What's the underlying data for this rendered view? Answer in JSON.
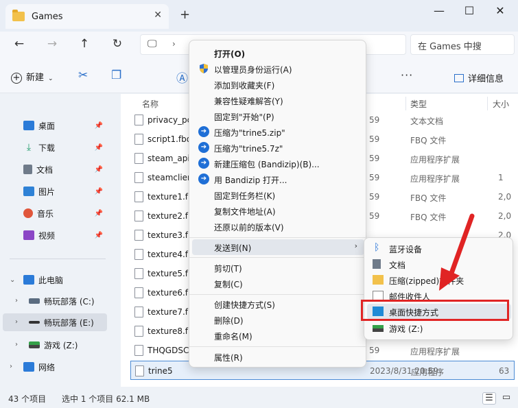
{
  "window": {
    "tab_title": "Games",
    "new_tab": "+",
    "minimize": "—",
    "maximize": "☐",
    "close": "✕"
  },
  "nav": {
    "search_placeholder": "在 Games 中搜"
  },
  "toolbar": {
    "new_label": "新建",
    "details_label": "详细信息"
  },
  "sidebar": {
    "quick": [
      {
        "label": "桌面",
        "color": "#2b7bd8"
      },
      {
        "label": "下载",
        "color": "#1e9a6a"
      },
      {
        "label": "文档",
        "color": "#6f7b8a"
      },
      {
        "label": "图片",
        "color": "#2f82d6"
      },
      {
        "label": "音乐",
        "color": "#e0563b"
      },
      {
        "label": "视频",
        "color": "#8b46c6"
      }
    ],
    "this_pc": "此电脑",
    "drives": [
      "畅玩部落 (C:)",
      "畅玩部落 (E:)",
      "游戏 (Z:)"
    ],
    "network": "网络"
  },
  "columns": {
    "name": "名称",
    "type": "类型",
    "size": "大小"
  },
  "files": [
    {
      "name": "privacy_pc",
      "date": "59",
      "type": "文本文档",
      "size": ""
    },
    {
      "name": "script1.fbq",
      "date": "59",
      "type": "FBQ 文件",
      "size": ""
    },
    {
      "name": "steam_api",
      "date": "59",
      "type": "应用程序扩展",
      "size": ""
    },
    {
      "name": "steamclien",
      "date": "59",
      "type": "应用程序扩展",
      "size": "1"
    },
    {
      "name": "texture1.fb",
      "date": "59",
      "type": "FBQ 文件",
      "size": "2,0"
    },
    {
      "name": "texture2.fb",
      "date": "59",
      "type": "FBQ 文件",
      "size": "2,0"
    },
    {
      "name": "texture3.fb",
      "date": "",
      "type": "",
      "size": "2,0"
    },
    {
      "name": "texture4.fb",
      "date": "",
      "type": "",
      "size": ""
    },
    {
      "name": "texture5.fb",
      "date": "",
      "type": "",
      "size": ""
    },
    {
      "name": "texture6.fb",
      "date": "",
      "type": "",
      "size": ""
    },
    {
      "name": "texture7.fb",
      "date": "",
      "type": "",
      "size": ""
    },
    {
      "name": "texture8.fb",
      "date": "",
      "type": "",
      "size": ""
    },
    {
      "name": "THQGDSC",
      "date": "59",
      "type": "应用程序扩展",
      "size": ""
    },
    {
      "name": "trine5",
      "date": "2023/8/31 20:59",
      "type": "应用程序",
      "size": "63"
    }
  ],
  "status": {
    "count": "43 个项目",
    "selected": "选中 1 个项目  62.1 MB"
  },
  "context_menu": [
    {
      "label": "打开(O)",
      "bold": true
    },
    {
      "label": "以管理员身份运行(A)"
    },
    {
      "label": "添加到收藏夹(F)"
    },
    {
      "label": "兼容性疑难解答(Y)"
    },
    {
      "label": "固定到\"开始\"(P)"
    },
    {
      "label": "压缩为\"trine5.zip\""
    },
    {
      "label": "压缩为\"trine5.7z\""
    },
    {
      "label": "新建压缩包 (Bandizip)(B)..."
    },
    {
      "label": "用 Bandizip 打开..."
    },
    {
      "label": "固定到任务栏(K)"
    },
    {
      "label": "复制文件地址(A)"
    },
    {
      "label": "还原以前的版本(V)"
    },
    {
      "label": "发送到(N)"
    },
    {
      "label": "剪切(T)"
    },
    {
      "label": "复制(C)"
    },
    {
      "label": "创建快捷方式(S)"
    },
    {
      "label": "删除(D)"
    },
    {
      "label": "重命名(M)"
    },
    {
      "label": "属性(R)"
    }
  ],
  "send_to": [
    {
      "label": "蓝牙设备"
    },
    {
      "label": "文档"
    },
    {
      "label": "压缩(zipped)文件夹"
    },
    {
      "label": "邮件收件人"
    },
    {
      "label": "桌面快捷方式"
    },
    {
      "label": "游戏 (Z:)"
    }
  ],
  "colors": {
    "accent": "#2a6fc9",
    "highlight_box": "#e02424",
    "annotation_arrow": "#e02424"
  }
}
